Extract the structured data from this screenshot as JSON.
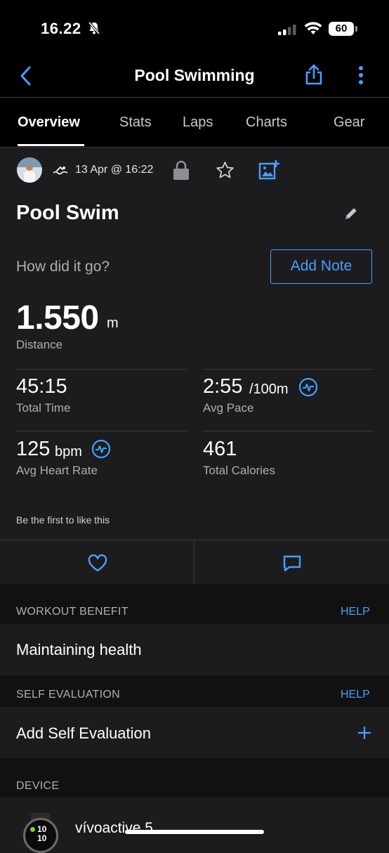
{
  "status_bar": {
    "time": "16.22",
    "battery": "60"
  },
  "nav": {
    "title": "Pool Swimming"
  },
  "tabs": [
    {
      "label": "Overview"
    },
    {
      "label": "Stats"
    },
    {
      "label": "Laps"
    },
    {
      "label": "Charts"
    },
    {
      "label": "Gear"
    }
  ],
  "activity": {
    "date": "13 Apr @ 16:22",
    "title": "Pool Swim",
    "note_prompt": "How did it go?",
    "add_note_label": "Add Note",
    "distance": {
      "value": "1.550",
      "unit": "m",
      "label": "Distance"
    },
    "total_time": {
      "value": "45:15",
      "label": "Total Time"
    },
    "avg_pace": {
      "value": "2:55",
      "unit": "/100m",
      "label": "Avg Pace"
    },
    "avg_hr": {
      "value": "125",
      "unit": "bpm",
      "label": "Avg Heart Rate"
    },
    "calories": {
      "value": "461",
      "label": "Total Calories"
    },
    "likes_text": "Be the first to like this"
  },
  "workout_benefit": {
    "header": "WORKOUT BENEFIT",
    "help": "HELP",
    "value": "Maintaining health"
  },
  "self_evaluation": {
    "header": "SELF EVALUATION",
    "help": "HELP",
    "value": "Add Self Evaluation"
  },
  "device": {
    "header": "DEVICE",
    "name": "vívoactive 5",
    "watch_face_text": "10"
  },
  "colors": {
    "accent": "#4a9eff",
    "background": "#1c1c1e",
    "bar": "#000000"
  }
}
